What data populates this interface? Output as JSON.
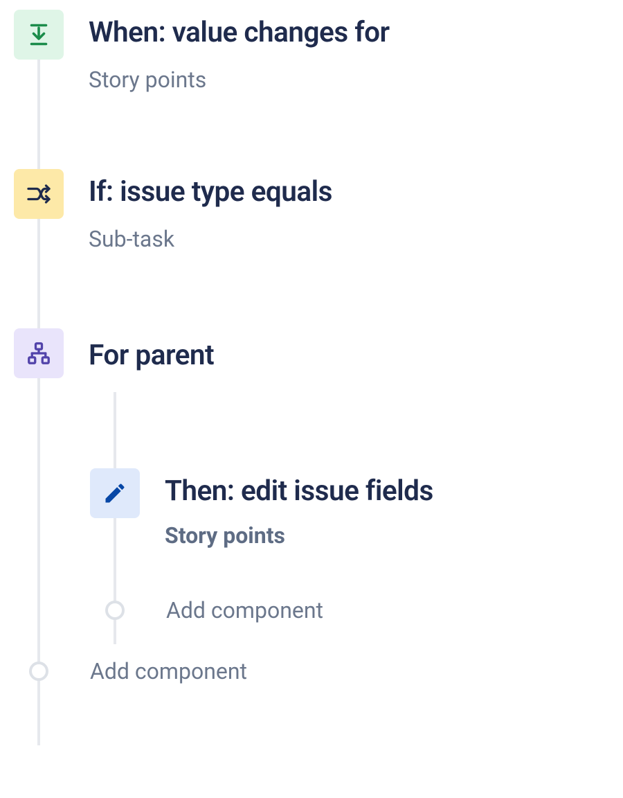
{
  "trigger": {
    "title": "When: value changes for",
    "subtitle": "Story points"
  },
  "condition": {
    "title": "If: issue type equals",
    "subtitle": "Sub-task"
  },
  "branch": {
    "title": "For parent"
  },
  "action": {
    "title": "Then: edit issue fields",
    "subtitle": "Story points"
  },
  "add_component_inner": "Add component",
  "add_component_outer": "Add component",
  "colors": {
    "trigger_bg": "#dff5e7",
    "trigger_fg": "#1b8c4b",
    "condition_bg": "#fde9a8",
    "condition_fg": "#1f2b4d",
    "branch_bg": "#e9e4fb",
    "branch_fg": "#5243aa",
    "action_bg": "#dfe9fb",
    "action_fg": "#0747a6"
  }
}
